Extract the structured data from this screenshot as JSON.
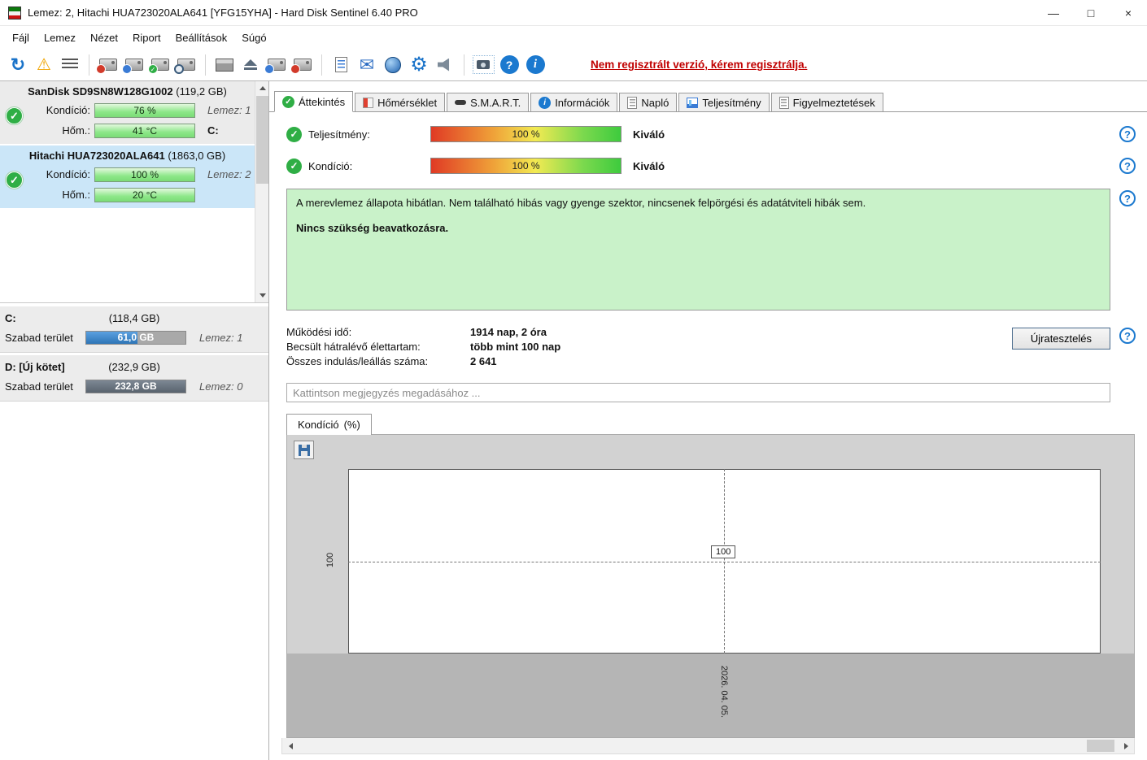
{
  "window": {
    "title": "Lemez: 2, Hitachi HUA723020ALA641 [YFG15YHA]  -  Hard Disk Sentinel 6.40 PRO",
    "controls": {
      "minimize": "—",
      "maximize": "□",
      "close": "×"
    }
  },
  "menu": {
    "items": [
      "Fájl",
      "Lemez",
      "Nézet",
      "Riport",
      "Beállítások",
      "Súgó"
    ]
  },
  "toolbar": {
    "register_notice": "Nem regisztrált verzió, kérem regisztrálja.",
    "icon_names": [
      "refresh",
      "acknowledge-warning",
      "report-options",
      "disk-remove",
      "disk-schedule",
      "disk-accept",
      "disk-surface-test",
      "hardware-device",
      "eject",
      "disk-repair",
      "disk-tools",
      "report",
      "send-email",
      "online-status",
      "settings",
      "sounds",
      "screenshot",
      "help",
      "information"
    ]
  },
  "icons": {
    "check": "✓",
    "refresh": "↻",
    "warning": "⚠",
    "gear": "⚙",
    "mail": "✉",
    "help": "?",
    "info": "i"
  },
  "colors": {
    "ok_green": "#2fae45",
    "selected_blue": "#cbe6f8",
    "register_red": "#c00000",
    "status_green_bg": "#c9f2c9",
    "free_space_blue": "#2e75b6"
  },
  "sidebar": {
    "disks": [
      {
        "name": "SanDisk SD9SN8W128G1002",
        "size": "(119,2 GB)",
        "condition_label": "Kondíció:",
        "condition_value": "76 %",
        "disk_no": "Lemez: 1",
        "temp_label": "Hőm.:",
        "temp_value": "41 °C",
        "drive_letter": "C:"
      },
      {
        "name": "Hitachi HUA723020ALA641",
        "size": "(1863,0 GB)",
        "condition_label": "Kondíció:",
        "condition_value": "100 %",
        "disk_no": "Lemez: 2",
        "temp_label": "Hőm.:",
        "temp_value": "20 °C",
        "drive_letter": ""
      }
    ],
    "partitions": [
      {
        "name": "C:",
        "size": "(118,4 GB)",
        "free_label": "Szabad terület",
        "free_value": "61,0 GB",
        "disk_no": "Lemez: 1",
        "fill_percent": 52
      },
      {
        "name": "D: [Új kötet]",
        "size": "(232,9 GB)",
        "free_label": "Szabad terület",
        "free_value": "232,8 GB",
        "disk_no": "Lemez: 0",
        "fill_percent": 100
      }
    ]
  },
  "tabs": {
    "active": "Áttekintés",
    "items": [
      {
        "label": "Áttekintés"
      },
      {
        "label": "Hőmérséklet"
      },
      {
        "label": "S.M.A.R.T."
      },
      {
        "label": "Információk"
      },
      {
        "label": "Napló"
      },
      {
        "label": "Teljesítmény"
      },
      {
        "label": "Figyelmeztetések"
      }
    ]
  },
  "overview": {
    "performance": {
      "label": "Teljesítmény:",
      "value": "100 %",
      "rating": "Kiváló"
    },
    "condition": {
      "label": "Kondíció:",
      "value": "100 %",
      "rating": "Kiváló"
    },
    "status_text": "A merevlemez állapota hibátlan. Nem található hibás vagy gyenge szektor, nincsenek felpörgési és adatátviteli hibák sem.",
    "status_action": "Nincs szükség beavatkozásra.",
    "stats": [
      {
        "label": "Működési idő:",
        "value": "1914 nap, 2 óra"
      },
      {
        "label": "Becsült hátralévő élettartam:",
        "value": "több mint 100 nap"
      },
      {
        "label": "Összes indulás/leállás száma:",
        "value": "2 641"
      }
    ],
    "retest_button": "Újratesztelés",
    "comment_placeholder": "Kattintson megjegyzés megadásához ...",
    "chart_tab": {
      "name": "Kondíció",
      "unit": "(%)"
    }
  },
  "chart_data": {
    "type": "line",
    "title": "Kondíció (%)",
    "x": [
      "2026. 04. 05."
    ],
    "series": [
      {
        "name": "Kondíció",
        "values": [
          100
        ]
      }
    ],
    "y_axis_label": "100",
    "point_label": "100",
    "grid": "dashed-crosshair",
    "legend": "none"
  }
}
